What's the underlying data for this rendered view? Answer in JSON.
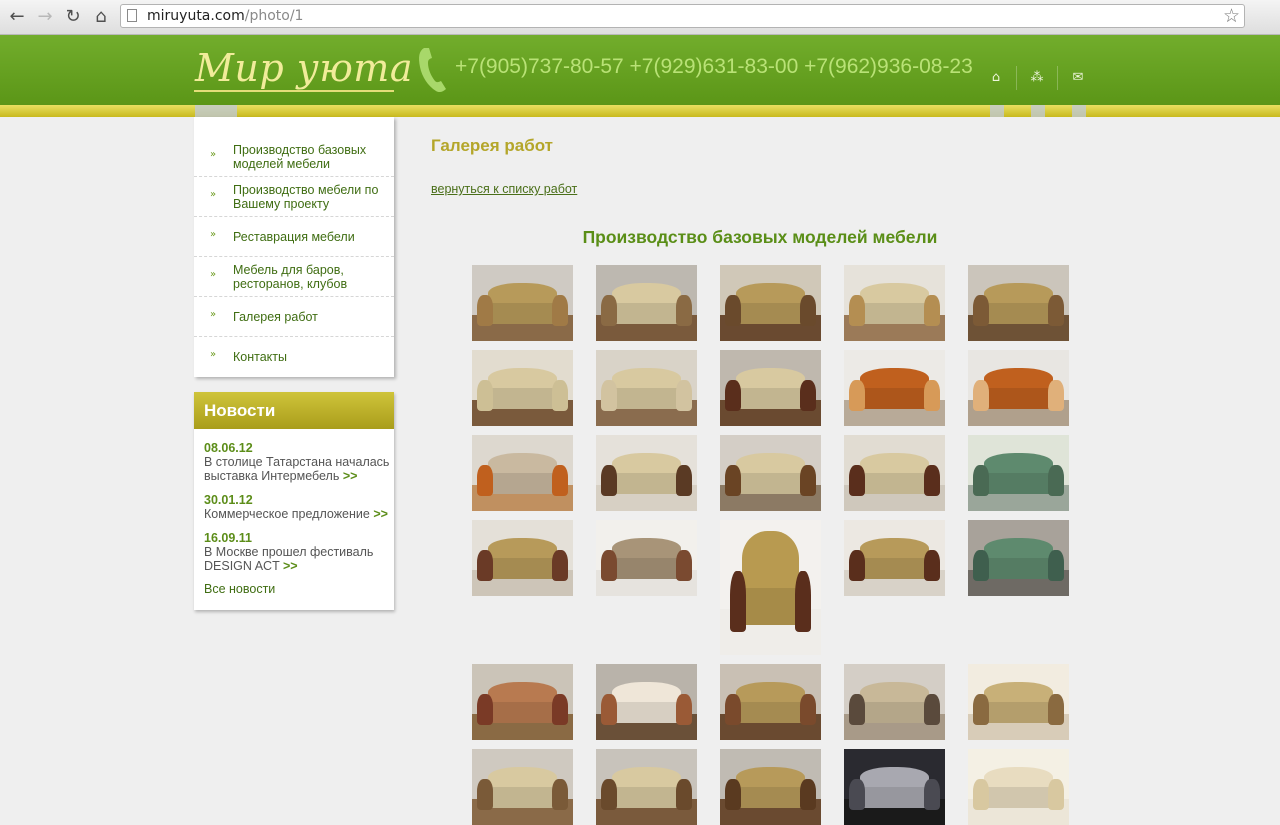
{
  "browser": {
    "url_domain": "miruyuta.com",
    "url_path": "/photo/1",
    "back_icon": "←",
    "forward_icon": "→",
    "reload_icon": "↻",
    "home_icon": "⌂",
    "star_icon": "☆"
  },
  "header": {
    "logo_text": "Мир уюта",
    "phones": "+7(905)737-80-57 +7(929)631-83-00 +7(962)936-08-23",
    "icons": {
      "home": "⌂",
      "sitemap": "⁂",
      "mail": "✉"
    }
  },
  "menu": {
    "bullet": "»",
    "items": [
      {
        "label": "Производство базовых моделей мебели"
      },
      {
        "label": "Производство мебели по Вашему проекту"
      },
      {
        "label": "Реставрация мебели"
      },
      {
        "label": "Мебель для баров, ресторанов, клубов"
      },
      {
        "label": "Галерея работ"
      },
      {
        "label": "Контакты"
      }
    ]
  },
  "news": {
    "title": "Новости",
    "items": [
      {
        "date": "08.06.12",
        "text": "В столице Татарстана началась выставка Интермебель",
        "more": ">>"
      },
      {
        "date": "30.01.12",
        "text": "Коммерческое предложение",
        "more": ">>"
      },
      {
        "date": "16.09.11",
        "text": "В Москве прошел фестиваль DESIGN ACT",
        "more": ">>"
      }
    ],
    "all_link": "Все новости"
  },
  "main": {
    "title": "Галерея работ",
    "back_link": "вернуться к списку работ",
    "section_title": "Производство базовых моделей мебели"
  },
  "gallery": {
    "description": "Grid of furniture photos (sofas, armchairs)",
    "palette": {
      "wall_light": "#d9d6cf",
      "floor_wood": "#7a5a3c",
      "gold_fabric": "#b79a5a",
      "beige_fabric": "#d8c9a0",
      "orange_leather": "#c0601e",
      "green_fabric": "#5e8a6e",
      "dark_wood": "#5a2e1c"
    }
  }
}
